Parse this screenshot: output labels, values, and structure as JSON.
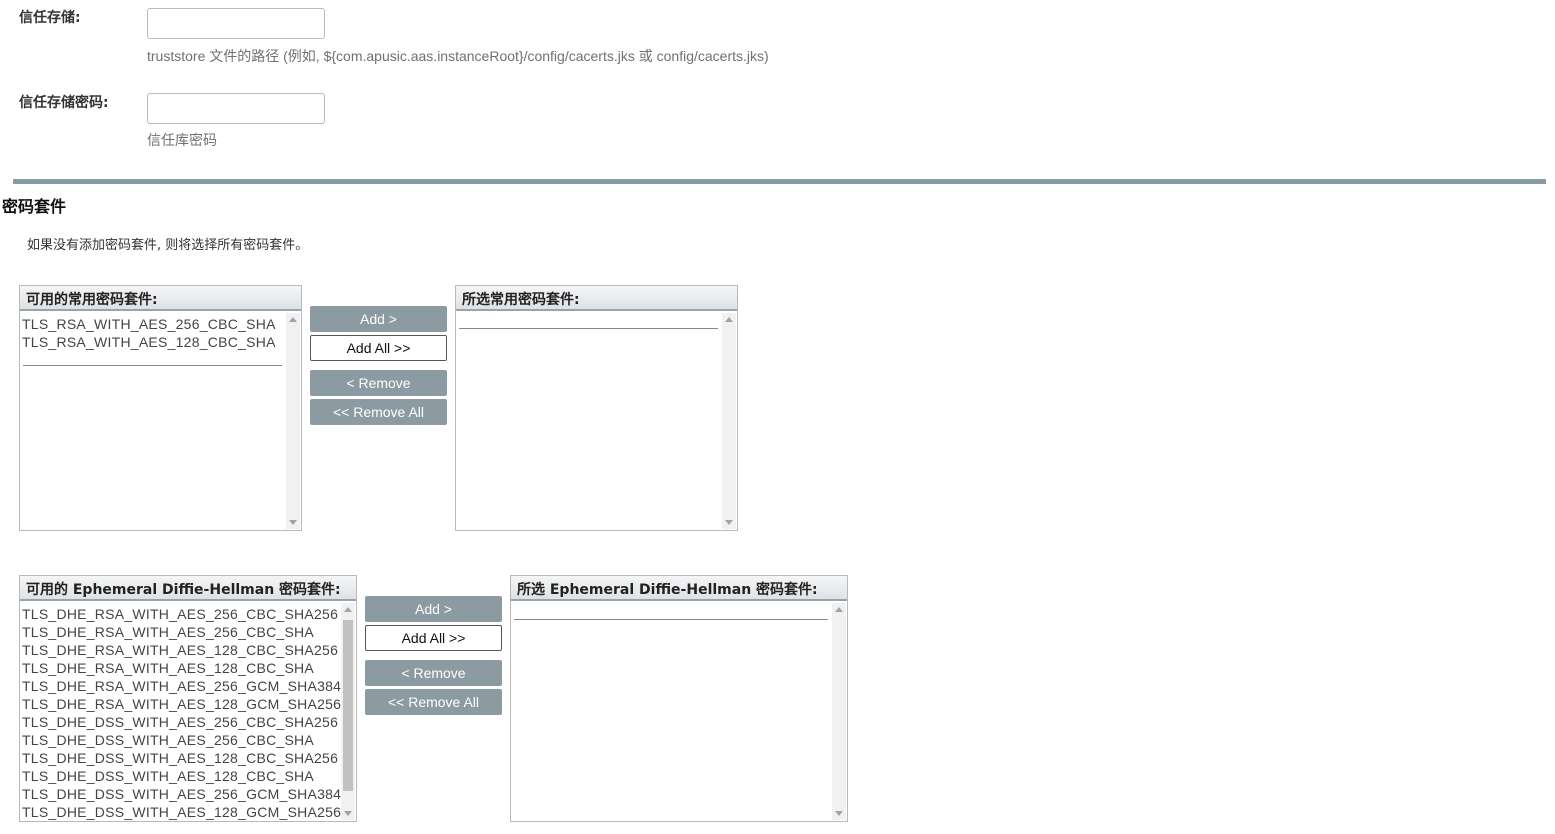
{
  "truststore": {
    "label": "信任存储:",
    "value": "",
    "help": "truststore 文件的路径 (例如, ${com.apusic.aas.instanceRoot}/config/cacerts.jks 或 config/cacerts.jks)"
  },
  "truststore_password": {
    "label": "信任存储密码:",
    "value": "",
    "help": "信任库密码"
  },
  "cipher_section": {
    "title": "密码套件",
    "note": "如果没有添加密码套件, 则将选择所有密码套件。"
  },
  "common": {
    "available_header": "可用的常用密码套件:",
    "available_items": [
      "TLS_RSA_WITH_AES_256_CBC_SHA",
      "TLS_RSA_WITH_AES_128_CBC_SHA"
    ],
    "selected_header": "所选常用密码套件:",
    "selected_items": []
  },
  "dh": {
    "available_header": "可用的 Ephemeral Diffie-Hellman 密码套件:",
    "available_items": [
      "TLS_DHE_RSA_WITH_AES_256_CBC_SHA256",
      "TLS_DHE_RSA_WITH_AES_256_CBC_SHA",
      "TLS_DHE_RSA_WITH_AES_128_CBC_SHA256",
      "TLS_DHE_RSA_WITH_AES_128_CBC_SHA",
      "TLS_DHE_RSA_WITH_AES_256_GCM_SHA384",
      "TLS_DHE_RSA_WITH_AES_128_GCM_SHA256",
      "TLS_DHE_DSS_WITH_AES_256_CBC_SHA256",
      "TLS_DHE_DSS_WITH_AES_256_CBC_SHA",
      "TLS_DHE_DSS_WITH_AES_128_CBC_SHA256",
      "TLS_DHE_DSS_WITH_AES_128_CBC_SHA",
      "TLS_DHE_DSS_WITH_AES_256_GCM_SHA384",
      "TLS_DHE_DSS_WITH_AES_128_GCM_SHA256"
    ],
    "selected_header": "所选 Ephemeral Diffie-Hellman 密码套件:",
    "selected_items": []
  },
  "buttons": {
    "add": "Add >",
    "add_all": "Add All >>",
    "remove": "< Remove",
    "remove_all": "<< Remove All"
  },
  "colors": {
    "divider": "#8a9ba3",
    "disabled_button": "#8c9ba2"
  }
}
